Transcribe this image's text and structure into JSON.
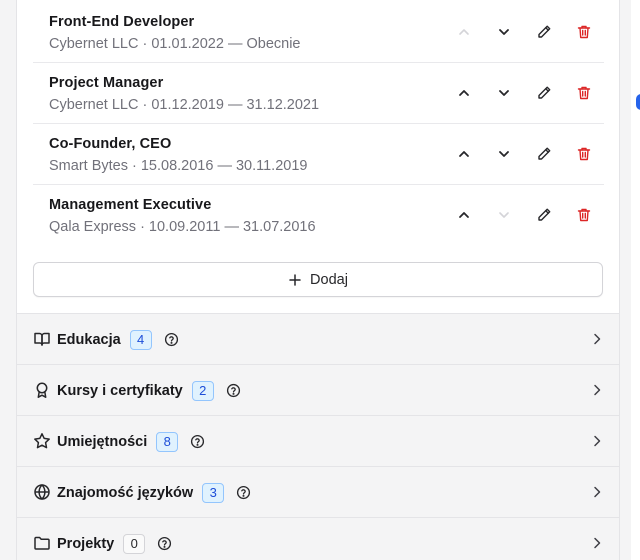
{
  "experience": {
    "items": [
      {
        "title": "Front-End Developer",
        "subtitle": "Cybernet LLC · 01.01.2022 — Obecnie",
        "can_up": false,
        "can_down": true
      },
      {
        "title": "Project Manager",
        "subtitle": "Cybernet LLC · 01.12.2019 — 31.12.2021",
        "can_up": true,
        "can_down": true
      },
      {
        "title": "Co-Founder, CEO",
        "subtitle": "Smart Bytes · 15.08.2016 — 30.11.2019",
        "can_up": true,
        "can_down": true
      },
      {
        "title": "Management Executive",
        "subtitle": "Qala Express · 10.09.2011 — 31.07.2016",
        "can_up": true,
        "can_down": false
      }
    ],
    "add_label": "Dodaj"
  },
  "sections": [
    {
      "label": "Edukacja",
      "count": "4",
      "icon": "book-open-icon"
    },
    {
      "label": "Kursy i certyfikaty",
      "count": "2",
      "icon": "award-icon"
    },
    {
      "label": "Umiejętności",
      "count": "8",
      "icon": "star-icon"
    },
    {
      "label": "Znajomość języków",
      "count": "3",
      "icon": "globe-icon"
    },
    {
      "label": "Projekty",
      "count": "0",
      "icon": "folder-icon"
    }
  ],
  "colors": {
    "accent": "#1d4ed8",
    "badge_bg": "#e0f2fe",
    "danger": "#dc2626",
    "muted_text": "#71717a"
  }
}
